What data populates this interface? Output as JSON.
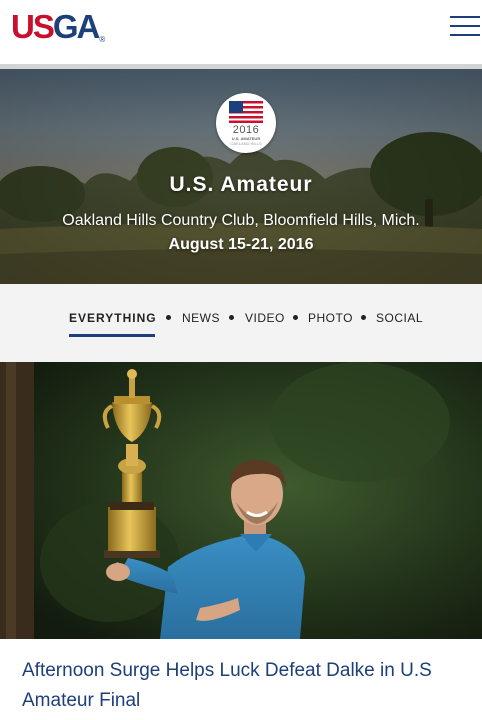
{
  "header": {
    "logo": {
      "letters_red": "US",
      "letters_blue": "GA",
      "reg_mark": "®"
    },
    "menu_icon": "hamburger-menu-icon"
  },
  "hero": {
    "badge": {
      "year": "2016",
      "name": "U.S. AMATEUR",
      "venue": "OAKLAND HILLS",
      "icon": "us-flag-icon"
    },
    "title": "U.S. Amateur",
    "venue": "Oakland Hills Country Club, Bloomfield Hills, Mich.",
    "dates": "August 15-21, 2016"
  },
  "filters": {
    "active": "EVERYTHING",
    "items": [
      {
        "label": "EVERYTHING"
      },
      {
        "label": "NEWS"
      },
      {
        "label": "VIDEO"
      },
      {
        "label": "PHOTO"
      },
      {
        "label": "SOCIAL"
      }
    ]
  },
  "article": {
    "image_alt": "Champion holding the Havemeyer Trophy",
    "headline": "Afternoon Surge Helps Luck Defeat Dalke in U.S Amateur Final"
  },
  "colors": {
    "brand_red": "#c8102e",
    "brand_blue": "#1d3f7a",
    "tab_bar_bg": "#f3f3f3"
  }
}
